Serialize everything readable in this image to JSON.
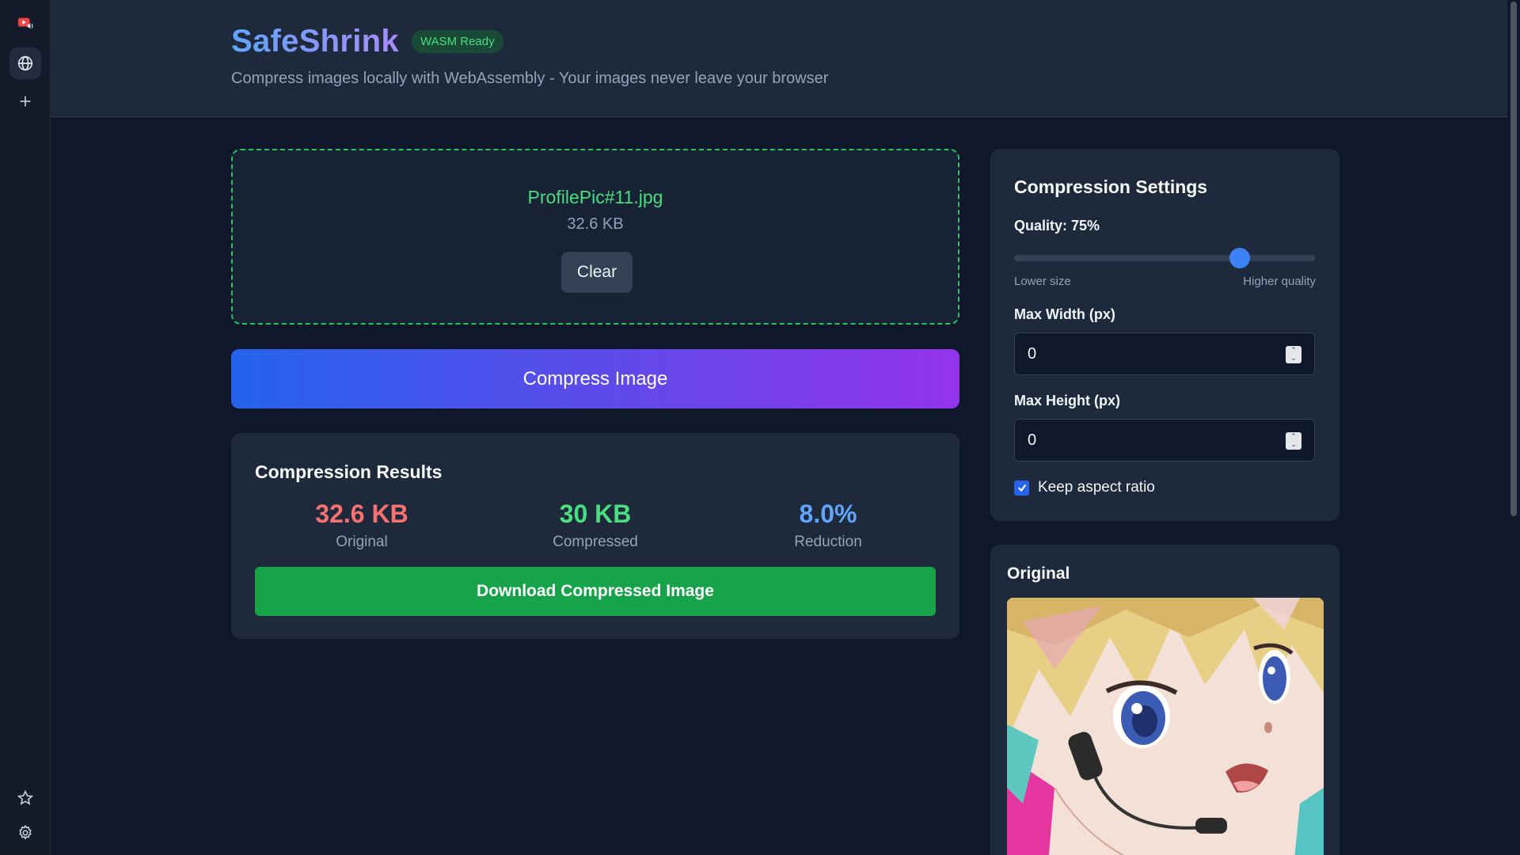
{
  "app": {
    "title": "SafeShrink",
    "badge": "WASM Ready",
    "subtitle": "Compress images locally with WebAssembly - Your images never leave your browser"
  },
  "file": {
    "name": "ProfilePic#11.jpg",
    "size": "32.6 KB",
    "clear_label": "Clear"
  },
  "compress_label": "Compress Image",
  "results": {
    "title": "Compression Results",
    "original": {
      "value": "32.6 KB",
      "label": "Original",
      "color": "#f87171"
    },
    "compressed": {
      "value": "30 KB",
      "label": "Compressed",
      "color": "#4ade80"
    },
    "reduction": {
      "value": "8.0%",
      "label": "Reduction",
      "color": "#60a5fa"
    },
    "download_label": "Download Compressed Image"
  },
  "settings": {
    "title": "Compression Settings",
    "quality_label": "Quality: 75%",
    "quality_value": 0.75,
    "slider_min_label": "Lower size",
    "slider_max_label": "Higher quality",
    "max_width_label": "Max Width (px)",
    "max_width_value": "0",
    "max_height_label": "Max Height (px)",
    "max_height_value": "0",
    "keep_aspect_label": "Keep aspect ratio",
    "keep_aspect_checked": true
  },
  "preview": {
    "title": "Original"
  },
  "browser_sidebar": {
    "icons": [
      "youtube-music-icon",
      "globe-icon",
      "plus-icon",
      "star-icon",
      "gear-icon"
    ]
  }
}
